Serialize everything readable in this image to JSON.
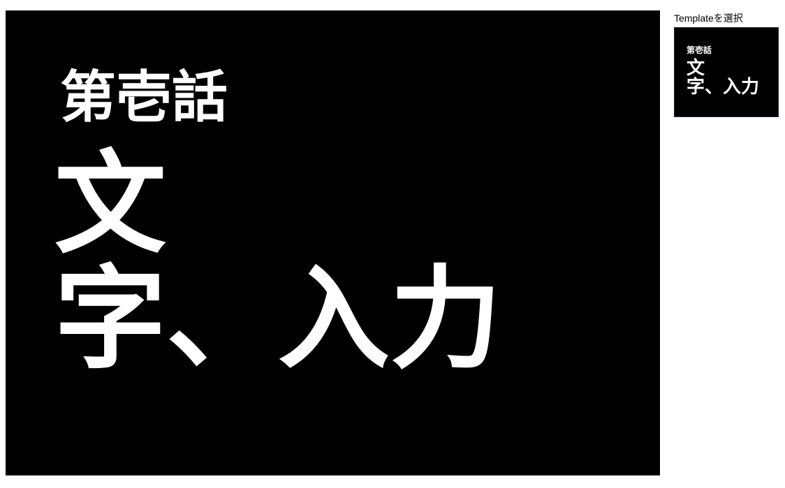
{
  "preview": {
    "subtitle": "第壱話",
    "title_lines": [
      "文",
      "字、入力"
    ]
  },
  "template_panel": {
    "label": "Templateを選択",
    "templates": [
      {
        "subtitle": "第壱話",
        "title_lines": [
          "文",
          "字、入力"
        ]
      }
    ]
  },
  "colors": {
    "canvas_bg": "#000000",
    "text": "#ffffff",
    "thumb_border": "#1a2340"
  }
}
